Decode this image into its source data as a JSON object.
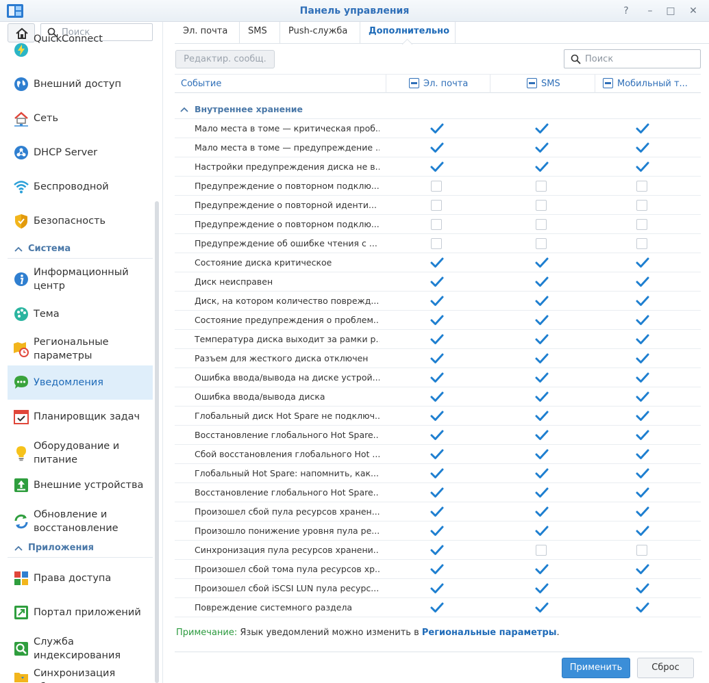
{
  "window": {
    "title": "Панель управления",
    "buttons": [
      "?",
      "–",
      "□",
      "✕"
    ]
  },
  "sidebar": {
    "search_placeholder": "Поиск",
    "items_top": [
      {
        "label": "QuickConnect",
        "icon": "quickconnect-icon"
      },
      {
        "label": "Внешний доступ",
        "icon": "globe-icon"
      },
      {
        "label": "Сеть",
        "icon": "network-house-icon"
      },
      {
        "label": "DHCP Server",
        "icon": "dhcp-icon"
      },
      {
        "label": "Беспроводной",
        "icon": "wifi-icon"
      },
      {
        "label": "Безопасность",
        "icon": "shield-icon"
      }
    ],
    "section_system": "Система",
    "items_system": [
      {
        "label": "Информационный центр",
        "icon": "info-icon"
      },
      {
        "label": "Тема",
        "icon": "palette-icon"
      },
      {
        "label": "Региональные параметры",
        "icon": "regional-clock-icon"
      },
      {
        "label": "Уведомления",
        "icon": "chat-bubble-icon",
        "active": true
      },
      {
        "label": "Планировщик задач",
        "icon": "calendar-check-icon"
      },
      {
        "label": "Оборудование и питание",
        "icon": "lightbulb-icon"
      },
      {
        "label": "Внешние устройства",
        "icon": "external-device-icon"
      },
      {
        "label": "Обновление и восстановление",
        "icon": "refresh-icon"
      }
    ],
    "section_apps": "Приложения",
    "items_apps": [
      {
        "label": "Права доступа",
        "icon": "app-privileges-icon"
      },
      {
        "label": "Портал приложений",
        "icon": "app-portal-icon"
      },
      {
        "label": "Служба индексирования",
        "icon": "search-index-icon"
      },
      {
        "label": "Синхронизация общих",
        "icon": "folder-sync-icon"
      }
    ]
  },
  "tabs": [
    {
      "label": "Эл. почта"
    },
    {
      "label": "SMS"
    },
    {
      "label": "Push-служба"
    },
    {
      "label": "Дополнительно",
      "active": true
    }
  ],
  "toolbar": {
    "edit_label": "Редактир. сообщ.",
    "search_placeholder": "Поиск"
  },
  "grid": {
    "columns": [
      "Событие",
      "Эл. почта",
      "SMS",
      "Мобильный т..."
    ],
    "group": "Внутреннее хранение",
    "rows": [
      {
        "event": "Мало места в томе — критическая проб...",
        "email": true,
        "sms": true,
        "mobile": true
      },
      {
        "event": "Мало места в томе — предупреждение ...",
        "email": true,
        "sms": true,
        "mobile": true
      },
      {
        "event": "Настройки предупреждения диска не в...",
        "email": true,
        "sms": true,
        "mobile": true
      },
      {
        "event": "Предупреждение о повторном подклю...",
        "email": false,
        "sms": false,
        "mobile": false
      },
      {
        "event": "Предупреждение о повторной иденти...",
        "email": false,
        "sms": false,
        "mobile": false
      },
      {
        "event": "Предупреждение о повторном подклю...",
        "email": false,
        "sms": false,
        "mobile": false
      },
      {
        "event": "Предупреждение об ошибке чтения с ...",
        "email": false,
        "sms": false,
        "mobile": false
      },
      {
        "event": "Состояние диска критическое",
        "email": true,
        "sms": true,
        "mobile": true
      },
      {
        "event": "Диск неисправен",
        "email": true,
        "sms": true,
        "mobile": true
      },
      {
        "event": "Диск, на котором количество поврежд...",
        "email": true,
        "sms": true,
        "mobile": true
      },
      {
        "event": "Состояние предупреждения о проблем...",
        "email": true,
        "sms": true,
        "mobile": true
      },
      {
        "event": "Температура диска выходит за рамки р...",
        "email": true,
        "sms": true,
        "mobile": true
      },
      {
        "event": "Разъем для жесткого диска отключен",
        "email": true,
        "sms": true,
        "mobile": true
      },
      {
        "event": "Ошибка ввода/вывода на диске устрой...",
        "email": true,
        "sms": true,
        "mobile": true
      },
      {
        "event": "Ошибка ввода/вывода диска",
        "email": true,
        "sms": true,
        "mobile": true
      },
      {
        "event": "Глобальный диск Hot Spare не подключ...",
        "email": true,
        "sms": true,
        "mobile": true
      },
      {
        "event": "Восстановление глобального Hot Spare...",
        "email": true,
        "sms": true,
        "mobile": true
      },
      {
        "event": "Сбой восстановления глобального Hot ...",
        "email": true,
        "sms": true,
        "mobile": true
      },
      {
        "event": "Глобальный Hot Spare: напомнить, как...",
        "email": true,
        "sms": true,
        "mobile": true
      },
      {
        "event": "Восстановление глобального Hot Spare...",
        "email": true,
        "sms": true,
        "mobile": true
      },
      {
        "event": "Произошел сбой пула ресурсов хранен...",
        "email": true,
        "sms": true,
        "mobile": true
      },
      {
        "event": "Произошло понижение уровня пула ре...",
        "email": true,
        "sms": true,
        "mobile": true
      },
      {
        "event": "Синхронизация пула ресурсов хранени...",
        "email": true,
        "sms": false,
        "mobile": false
      },
      {
        "event": "Произошел сбой тома пула ресурсов хр...",
        "email": true,
        "sms": true,
        "mobile": true
      },
      {
        "event": "Произошел сбой iSCSI LUN пула ресурс...",
        "email": true,
        "sms": true,
        "mobile": true
      },
      {
        "event": "Повреждение системного раздела",
        "email": true,
        "sms": true,
        "mobile": true
      }
    ]
  },
  "note": {
    "prefix": "Примечание:",
    "text": " Язык уведомлений можно изменить в ",
    "link": "Региональные параметры",
    "suffix": "."
  },
  "footer": {
    "apply_label": "Применить",
    "reset_label": "Сброс"
  },
  "colors": {
    "accent": "#1f6bb8",
    "check": "#1e7fd0",
    "active_bg": "#dfeefa",
    "note_key": "#2b9a3e"
  }
}
